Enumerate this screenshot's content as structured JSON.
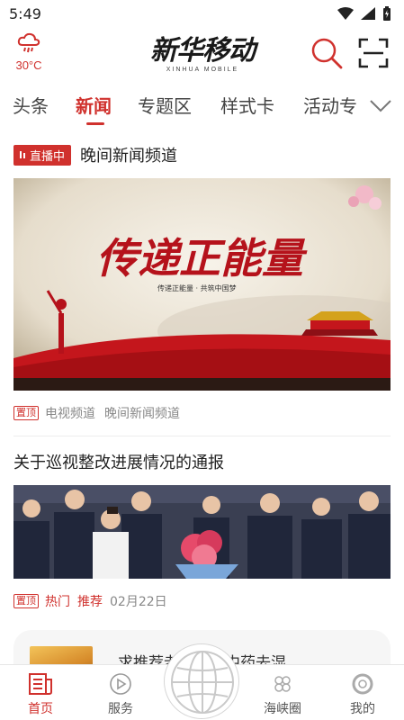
{
  "status_bar": {
    "time": "5:49"
  },
  "header": {
    "weather_temp": "30°C",
    "logo_main": "新华移动",
    "logo_sub": "XINHUA MOBILE",
    "accent_color": "#d0312d"
  },
  "tabs": [
    {
      "label": "头条",
      "active": false
    },
    {
      "label": "新闻",
      "active": true
    },
    {
      "label": "专题区",
      "active": false
    },
    {
      "label": "样式卡",
      "active": false
    },
    {
      "label": "活动专",
      "active": false
    }
  ],
  "live": {
    "badge": "直播中",
    "title": "晚间新闻频道"
  },
  "feed": [
    {
      "banner_text": "传递正能量",
      "banner_subtext": "传递正能量 · 共筑中国梦",
      "tag": "置顶",
      "meta": [
        "电视频道",
        "晚间新闻频道"
      ]
    },
    {
      "title": "关于巡视整改进展情况的通报",
      "tag": "置顶",
      "hot": "热门",
      "recommend": "推荐",
      "date": "02月22日"
    },
    {
      "title": "求推荐老…想喝中药去湿"
    }
  ],
  "bottom_nav": [
    {
      "label": "首页",
      "icon": "newspaper-icon",
      "active": true
    },
    {
      "label": "服务",
      "icon": "play-circle-icon",
      "active": false
    },
    {
      "label": "海峡圈",
      "icon": "clover-icon",
      "active": false
    },
    {
      "label": "我的",
      "icon": "user-circle-icon",
      "active": false
    }
  ]
}
